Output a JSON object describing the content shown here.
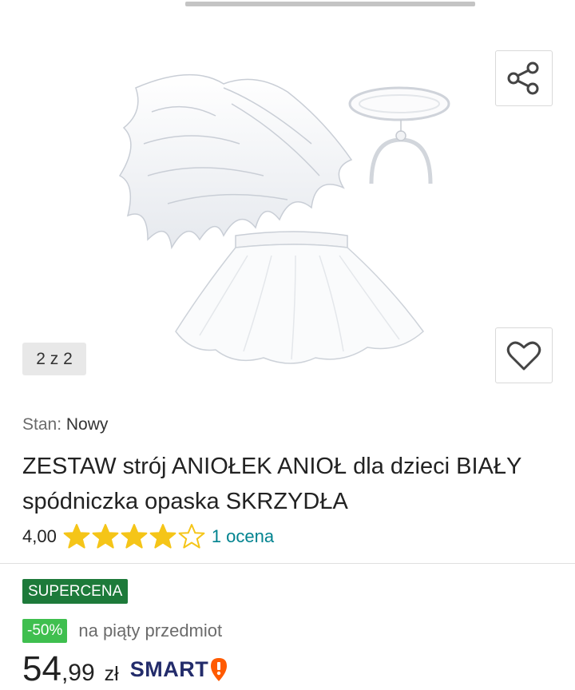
{
  "gallery": {
    "counter": "2 z 2",
    "image_alt": "ZESTAW strój ANIOŁEK ANIOŁ dla dzieci BIAŁY spódniczka opaska SKRZYDŁA"
  },
  "product": {
    "condition_label": "Stan:",
    "condition_value": "Nowy",
    "title": "ZESTAW strój ANIOŁEK ANIOŁ dla dzieci BIAŁY spódniczka opaska SKRZYDŁA",
    "rating_score": "4,00",
    "rating_stars": 4,
    "rating_max": 5,
    "rating_count": "1 ocena"
  },
  "pricing": {
    "badge": "SUPERCENA",
    "discount_badge": "-50%",
    "discount_text": "na piąty przedmiot",
    "price_int": "54",
    "price_dec": ",99",
    "currency": "zł",
    "smart_label": "SMART"
  },
  "colors": {
    "star": "#f5c518",
    "link": "#00838f",
    "supercena_bg": "#1d7a3a",
    "discount_bg": "#3fbf4f",
    "smart_blue": "#232c6b",
    "smart_orange": "#ff5a00"
  },
  "icons": {
    "share": "share-icon",
    "favorite": "heart-icon",
    "star": "star-icon",
    "smart": "smart-logo-icon"
  }
}
